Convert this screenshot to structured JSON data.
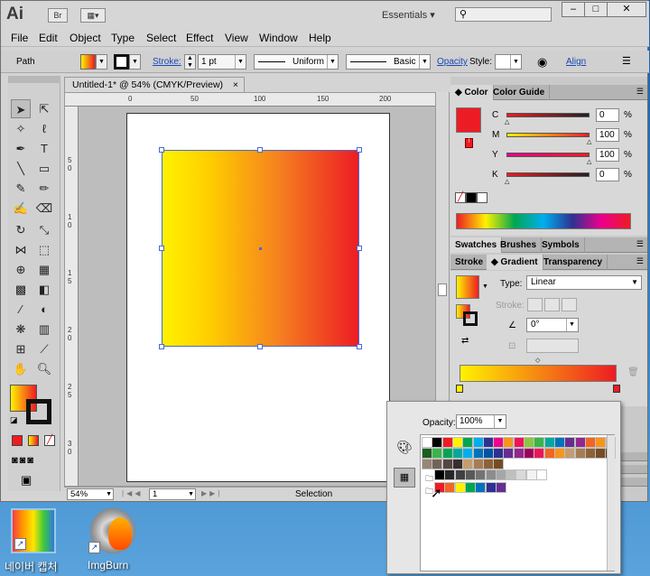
{
  "app": {
    "logo": "Ai",
    "bridge": "Br",
    "workspace": "Essentials"
  },
  "menu": [
    "File",
    "Edit",
    "Object",
    "Type",
    "Select",
    "Effect",
    "View",
    "Window",
    "Help"
  ],
  "control": {
    "selection_type": "Path",
    "stroke_label": "Stroke:",
    "stroke_weight": "1 pt",
    "profile": "Uniform",
    "brush": "Basic",
    "opacity_label": "Opacity",
    "style_label": "Style:",
    "align_label": "Align"
  },
  "document": {
    "tab_title": "Untitled-1* @ 54% (CMYK/Preview)",
    "ruler_h": [
      "0",
      "50",
      "100",
      "150",
      "200"
    ],
    "ruler_v": [
      "5",
      "0",
      "1",
      "0",
      "1",
      "5",
      "2",
      "0",
      "2",
      "5",
      "3",
      "0"
    ]
  },
  "status": {
    "zoom": "54%",
    "page": "1",
    "mode": "Selection"
  },
  "color_panel": {
    "tabs": [
      "Color",
      "Color Guide"
    ],
    "channels": [
      {
        "name": "C",
        "value": "0",
        "unit": "%",
        "level": 0.0
      },
      {
        "name": "M",
        "value": "100",
        "unit": "%",
        "level": 1.0
      },
      {
        "name": "Y",
        "value": "100",
        "unit": "%",
        "level": 1.0
      },
      {
        "name": "K",
        "value": "0",
        "unit": "%",
        "level": 0.0
      }
    ],
    "fill_color": "#ed1c24"
  },
  "swatches_tabs": [
    "Swatches",
    "Brushes",
    "Symbols"
  ],
  "gradient_panel": {
    "tabs": [
      "Stroke",
      "Gradient",
      "Transparency"
    ],
    "type_label": "Type:",
    "type_value": "Linear",
    "stroke_label": "Stroke:",
    "angle_value": "0°"
  },
  "swatch_popup": {
    "opacity_label": "Opacity:",
    "opacity_value": "100%"
  },
  "desktop": {
    "icons": [
      "네이버 캡처",
      "ImgBurn"
    ]
  }
}
